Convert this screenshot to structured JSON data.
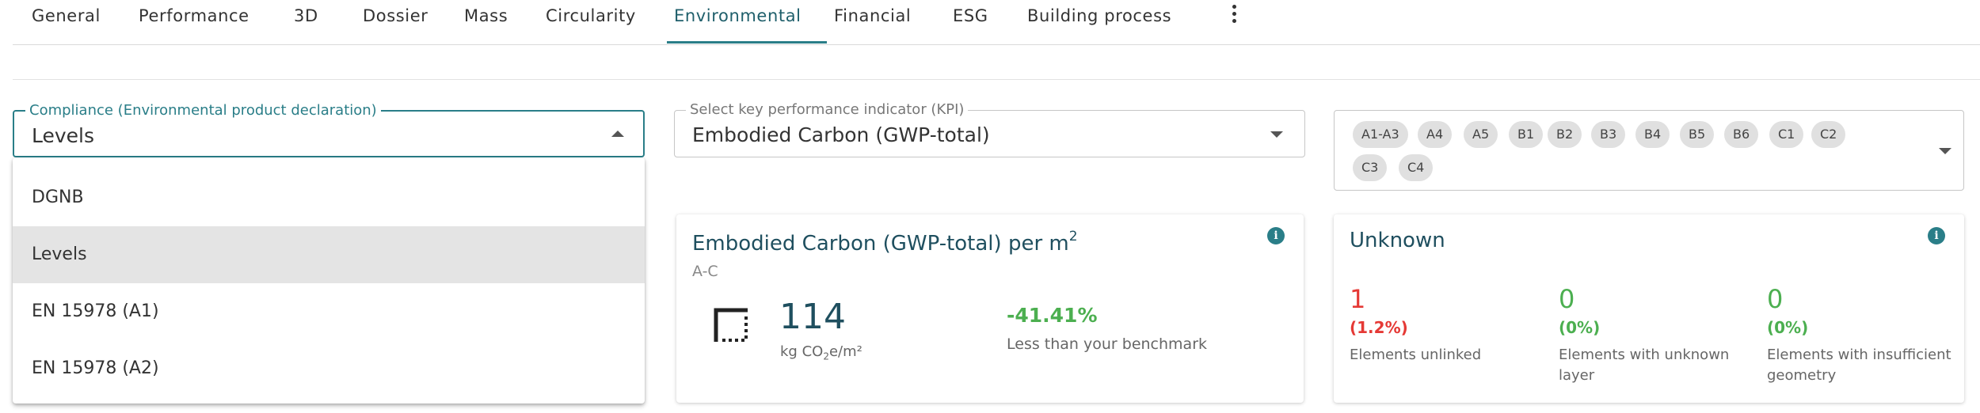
{
  "tabs": [
    {
      "label": "General"
    },
    {
      "label": "Performance"
    },
    {
      "label": "3D"
    },
    {
      "label": "Dossier"
    },
    {
      "label": "Mass"
    },
    {
      "label": "Circularity"
    },
    {
      "label": "Environmental"
    },
    {
      "label": "Financial"
    },
    {
      "label": "ESG"
    },
    {
      "label": "Building process"
    }
  ],
  "active_tab": "Environmental",
  "compliance": {
    "label": "Compliance (Environmental product declaration)",
    "value": "Levels",
    "options": [
      {
        "label": "DGNB"
      },
      {
        "label": "Levels",
        "selected": true
      },
      {
        "label": "EN 15978 (A1)"
      },
      {
        "label": "EN 15978 (A2)"
      }
    ]
  },
  "kpi": {
    "label": "Select key performance indicator (KPI)",
    "value": "Embodied Carbon (GWP-total)"
  },
  "stages": {
    "chips": [
      "A1-A3",
      "A4",
      "A5",
      "B1",
      "B2",
      "B3",
      "B4",
      "B5",
      "B6",
      "C1",
      "C2",
      "C3",
      "C4"
    ]
  },
  "carbon_card": {
    "title": "Embodied Carbon (GWP-total) per m",
    "title_sup": "2",
    "subtitle": "A-C",
    "value": "114",
    "unit_prefix": "kg CO",
    "unit_sub": "2",
    "unit_suffix": "e/m²",
    "change": "-41.41%",
    "change_label": "Less than your benchmark"
  },
  "unknown_card": {
    "title": "Unknown",
    "stats": [
      {
        "value": "1",
        "pct": "(1.2%)",
        "label": "Elements unlinked"
      },
      {
        "value": "0",
        "pct": "(0%)",
        "label": "Elements with unknown layer"
      },
      {
        "value": "0",
        "pct": "(0%)",
        "label": "Elements with insufficient geometry"
      }
    ]
  },
  "colors": {
    "accent": "#2a7e88",
    "positive": "#4caf50",
    "negative": "#e53935",
    "title": "#1f4f5f"
  },
  "icons": [
    "more-vert-icon",
    "arrow-drop-up-icon",
    "arrow-drop-down-icon",
    "info-icon",
    "floor-area-icon"
  ]
}
